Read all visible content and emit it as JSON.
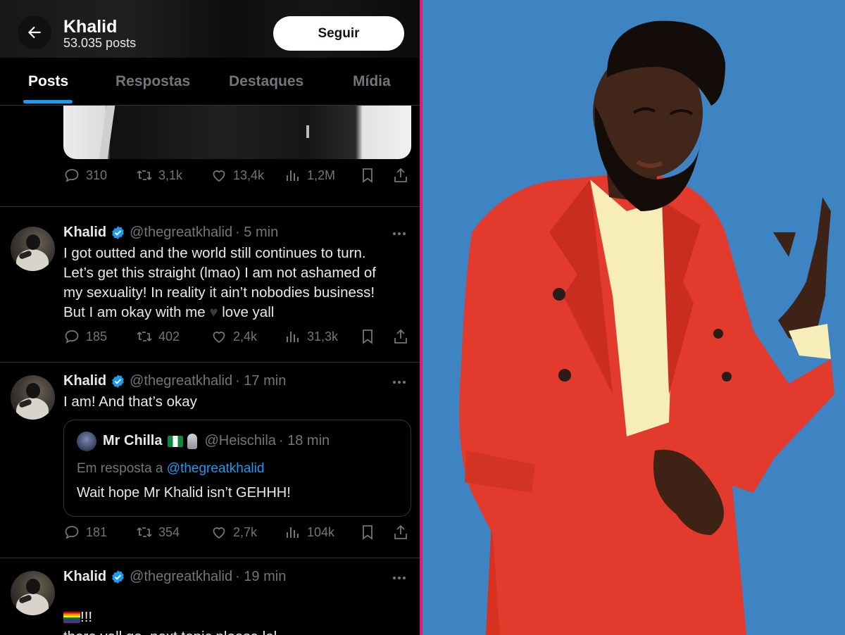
{
  "header": {
    "name": "Khalid",
    "post_count": "53.035 posts",
    "follow_label": "Seguir"
  },
  "tabs": [
    {
      "label": "Posts",
      "active": true
    },
    {
      "label": "Respostas",
      "active": false
    },
    {
      "label": "Destaques",
      "active": false
    },
    {
      "label": "Mídia",
      "active": false
    }
  ],
  "colors": {
    "accent_blue": "#1d9bf0",
    "divider_pink": "#e21a73",
    "photo_background": "#3f84c2",
    "suit_red": "#e23a2c"
  },
  "tweets": [
    {
      "stats": {
        "replies": "310",
        "reposts": "3,1k",
        "likes": "13,4k",
        "views": "1,2M"
      }
    },
    {
      "name": "Khalid",
      "handle": "@thegreatkhalid",
      "time": "· 5 min",
      "text": "I got outted and the world still continues to turn.\nLet’s get this straight (lmao) I am not ashamed of\nmy sexuality! In reality it ain’t nobodies business!\nBut I am okay with me",
      "text_end": " love yall",
      "stats": {
        "replies": "185",
        "reposts": "402",
        "likes": "2,4k",
        "views": "31,3k"
      }
    },
    {
      "name": "Khalid",
      "handle": "@thegreatkhalid",
      "time": "· 17 min",
      "text": "I am! And that’s okay",
      "quote": {
        "name": "Mr Chilla",
        "handle": "@Heischila",
        "time": "· 18 min",
        "reply_prefix": "Em resposta a",
        "reply_mention": "@thegreatkhalid",
        "text": "Wait hope Mr Khalid isn’t GEHHH!"
      },
      "stats": {
        "replies": "181",
        "reposts": "354",
        "likes": "2,7k",
        "views": "104k"
      }
    },
    {
      "name": "Khalid",
      "handle": "@thegreatkhalid",
      "time": "· 19 min",
      "text_line1": "!!!",
      "text_line2": "there yall go. next topic please lol"
    }
  ],
  "icons": [
    "back-arrow-icon",
    "verified-badge-icon",
    "more-icon",
    "reply-icon",
    "repost-icon",
    "like-icon",
    "views-icon",
    "bookmark-icon",
    "share-icon",
    "rainbow-flag-emoji",
    "nigeria-flag-emoji",
    "microphone-emoji",
    "black-heart-emoji"
  ]
}
